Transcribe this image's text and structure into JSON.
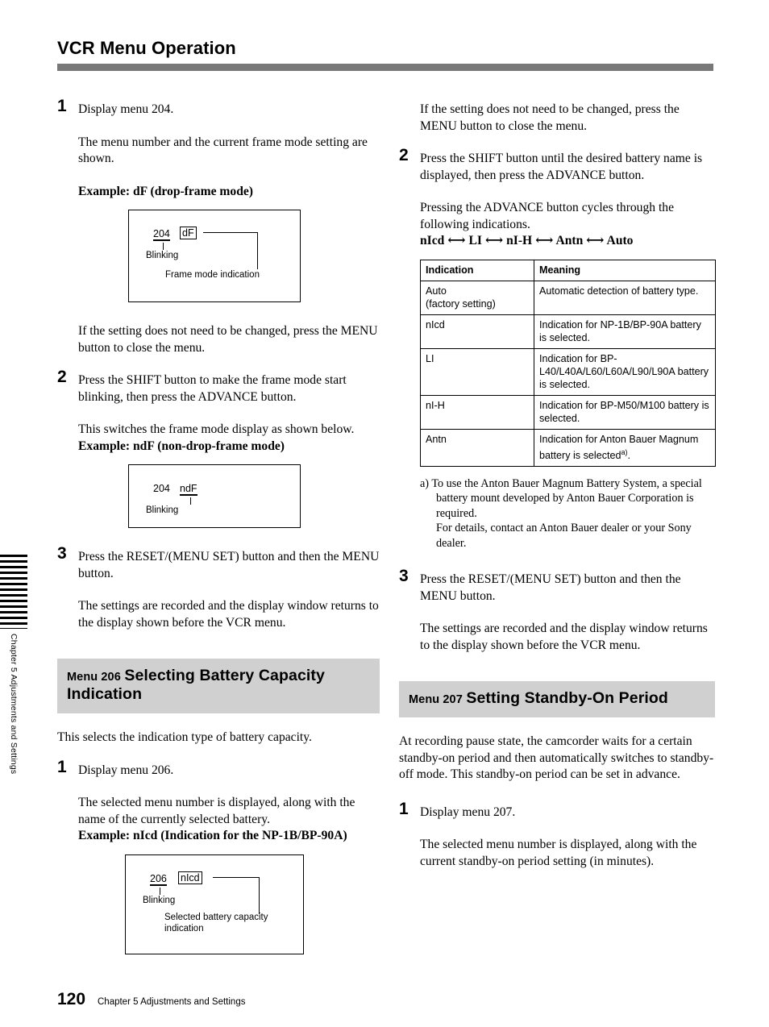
{
  "page": {
    "title": "VCR Menu Operation",
    "folio": "120",
    "footer_text": "Chapter 5   Adjustments and Settings",
    "side_tab_label": "Chapter 5 Adjustments and Settings",
    "rule_color": "#787878",
    "band_color": "#d0d0d0"
  },
  "left_column": {
    "step1": {
      "number": "1",
      "text": "Display menu 204.",
      "para1": "The menu number and the current frame mode setting are shown.",
      "example_label": "Example: dF (drop-frame mode)",
      "diagram": {
        "menu_number": "204",
        "value": "dF",
        "blinking_label": "Blinking",
        "callout_label": "Frame mode indication"
      },
      "para2": "If the setting does not need to be changed, press the MENU button to close the menu."
    },
    "step2": {
      "number": "2",
      "text": "Press the SHIFT button to make the frame mode start blinking, then press the ADVANCE button.",
      "para1": "This switches the frame mode display as shown below.",
      "example_label": "Example: ndF (non-drop-frame mode)",
      "diagram": {
        "menu_number": "204",
        "value": "ndF",
        "blinking_label": "Blinking"
      }
    },
    "step3": {
      "number": "3",
      "text": "Press the RESET/(MENU SET) button and then the MENU button.",
      "para1": "The settings are recorded and the display window returns to the display shown before the VCR menu."
    },
    "section": {
      "menu_label": "Menu 206",
      "title": "Selecting Battery Capacity Indication",
      "intro": "This selects the indication type of battery capacity.",
      "step1": {
        "number": "1",
        "text": "Display menu 206.",
        "para1": "The selected menu number is displayed, along with the name of the currently selected battery.",
        "example_label": "Example: nIcd (Indication for the NP-1B/BP-90A)",
        "diagram": {
          "menu_number": "206",
          "value": "nIcd",
          "blinking_label": "Blinking",
          "callout_label": "Selected battery capacity indication"
        }
      }
    }
  },
  "right_column": {
    "para_top": "If the setting does not need to be changed, press the MENU button to close the menu.",
    "step2": {
      "number": "2",
      "text": "Press the SHIFT button until the desired battery name is displayed, then press the ADVANCE button.",
      "para1": "Pressing the ADVANCE button cycles through the following indications.",
      "cycle": "nIcd ⟷ LI ⟷ nI-H ⟷ Antn ⟷ Auto"
    },
    "table": {
      "headers": [
        "Indication",
        "Meaning"
      ],
      "rows": [
        {
          "indication": "Auto\n(factory setting)",
          "meaning": "Automatic detection of battery type.",
          "footnote_marker": ""
        },
        {
          "indication": "nIcd",
          "meaning": "Indication for NP-1B/BP-90A battery is selected.",
          "footnote_marker": ""
        },
        {
          "indication": "LI",
          "meaning": "Indication for BP-L40/L40A/L60/L60A/L90/L90A battery is selected.",
          "footnote_marker": ""
        },
        {
          "indication": "nI-H",
          "meaning": "Indication for BP-M50/M100 battery is selected.",
          "footnote_marker": ""
        },
        {
          "indication": "Antn",
          "meaning": "Indication for Anton Bauer Magnum battery is selected",
          "footnote_marker": "a)"
        }
      ]
    },
    "footnote": {
      "marker": "a)",
      "line1": "To use the Anton Bauer Magnum Battery System, a special battery mount developed by Anton Bauer Corporation is required.",
      "line2": "For details, contact an Anton Bauer dealer or your Sony dealer."
    },
    "step3": {
      "number": "3",
      "text": "Press the RESET/(MENU SET) button and then the MENU button.",
      "para1": "The settings are recorded and the display window returns to the display shown before the VCR menu."
    },
    "section": {
      "menu_label": "Menu 207",
      "title": "Setting Standby-On Period",
      "intro": "At recording pause state, the camcorder waits for a certain standby-on period and then automatically switches to standby-off mode. This standby-on period can be set in advance.",
      "step1": {
        "number": "1",
        "text": "Display menu 207.",
        "para1": "The selected menu number is displayed, along with the current standby-on period setting (in minutes)."
      }
    }
  }
}
